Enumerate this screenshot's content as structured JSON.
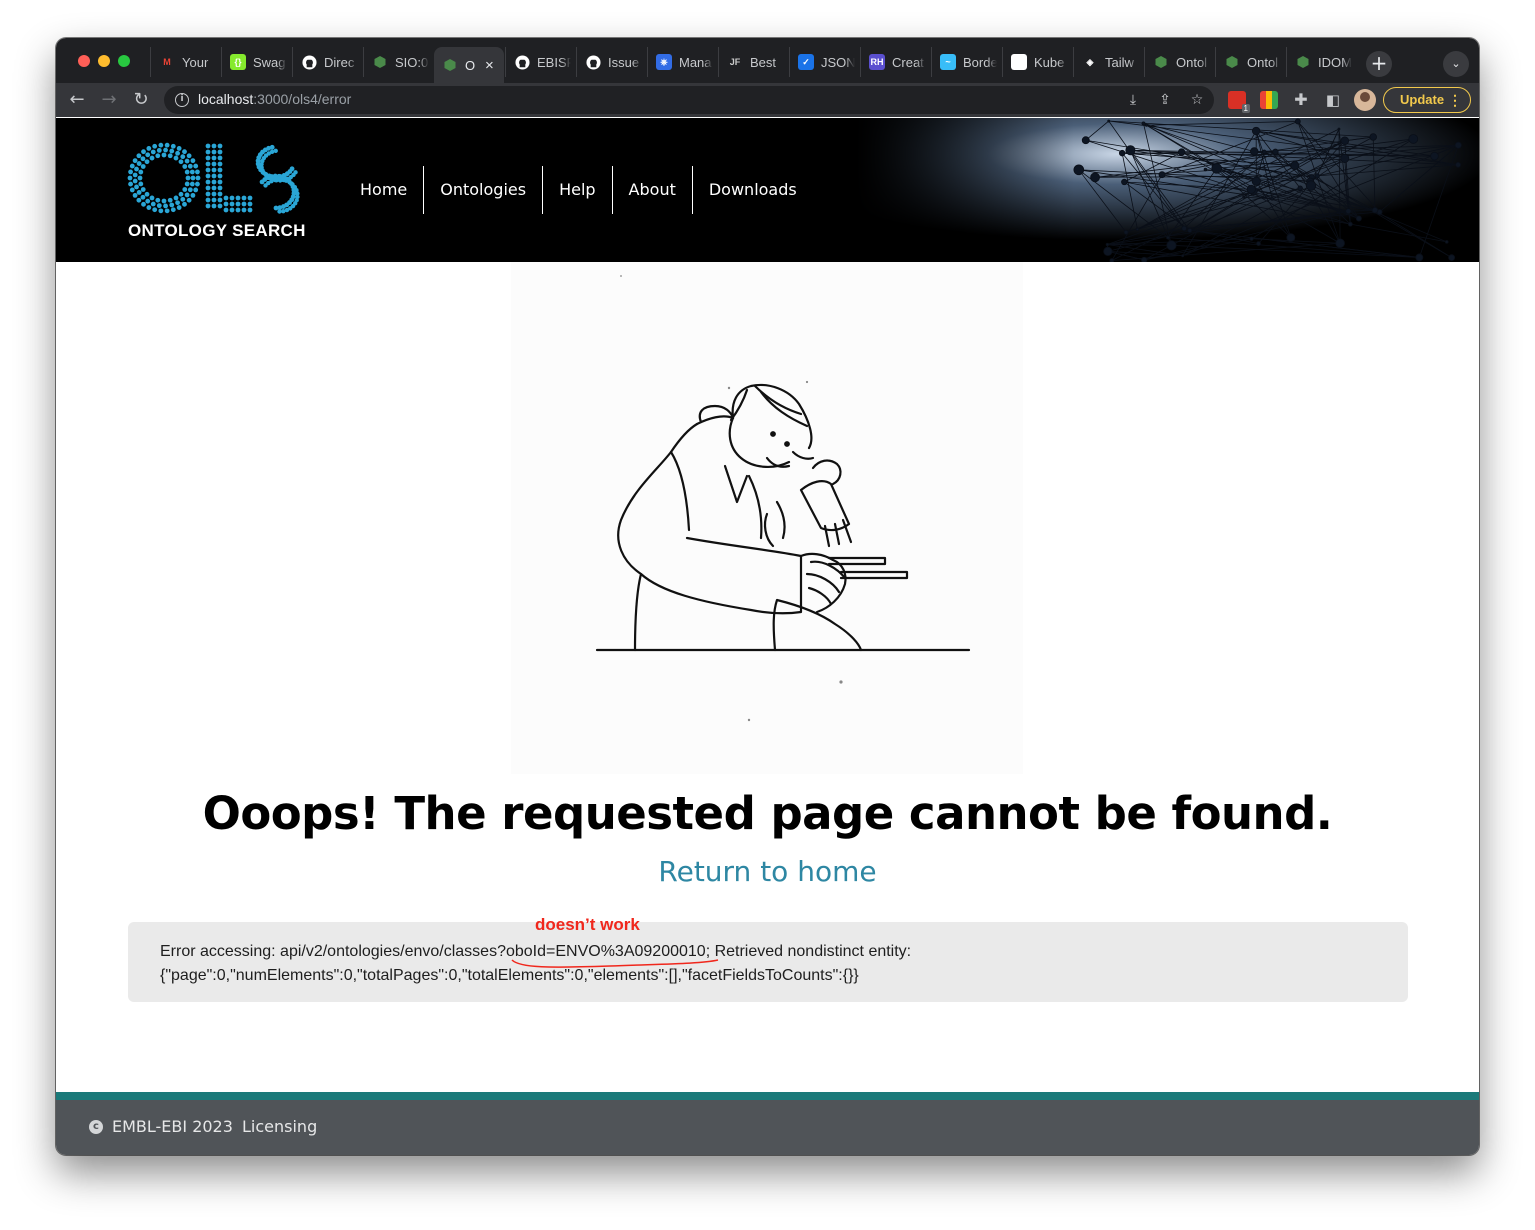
{
  "browser": {
    "tabs": [
      {
        "title": "Your",
        "icon": "gmail-icon",
        "color": "#ea4335",
        "glyph": "M"
      },
      {
        "title": "Swag",
        "icon": "swagger-icon",
        "color": "#85ea2d",
        "glyph": "{}"
      },
      {
        "title": "Direc",
        "icon": "github-icon",
        "color": "#ffffff",
        "glyph": ""
      },
      {
        "title": "SIO:0",
        "icon": "hexagon-icon",
        "color": "#4a8a4a",
        "glyph": ""
      },
      {
        "title": "O",
        "icon": "hexagon-icon",
        "color": "#4a8a4a",
        "glyph": "",
        "active": true
      },
      {
        "title": "EBISF",
        "icon": "github-icon",
        "color": "#ffffff",
        "glyph": ""
      },
      {
        "title": "Issue",
        "icon": "github-icon",
        "color": "#ffffff",
        "glyph": ""
      },
      {
        "title": "Mana",
        "icon": "kubernetes-icon",
        "color": "#326ce5",
        "glyph": "⎈"
      },
      {
        "title": "Best",
        "icon": "jf-icon",
        "color": "#2b2b2b",
        "glyph": "JF"
      },
      {
        "title": "JSON",
        "icon": "checkbox-icon",
        "color": "#1a73e8",
        "glyph": "✓"
      },
      {
        "title": "Creat",
        "icon": "rh-icon",
        "color": "#5a4fcf",
        "glyph": "RH"
      },
      {
        "title": "Borde",
        "icon": "tailwind-icon",
        "color": "#38bdf8",
        "glyph": "~"
      },
      {
        "title": "Kube",
        "icon": "page-icon",
        "color": "#e8eaed",
        "glyph": ""
      },
      {
        "title": "Tailw",
        "icon": "codepen-icon",
        "color": "#ffffff",
        "glyph": "◈"
      },
      {
        "title": "Ontol",
        "icon": "hexagon-icon",
        "color": "#4a8a4a",
        "glyph": ""
      },
      {
        "title": "Ontol",
        "icon": "hexagon-icon",
        "color": "#4a8a4a",
        "glyph": ""
      },
      {
        "title": "IDOM",
        "icon": "hexagon-icon",
        "color": "#4a8a4a",
        "glyph": ""
      }
    ],
    "url_host": "localhost",
    "url_path": ":3000/ols4/error",
    "update_label": "Update",
    "extension_badge": "1"
  },
  "site": {
    "logo_text": "OLS",
    "logo_tagline": "ONTOLOGY SEARCH",
    "nav": [
      "Home",
      "Ontologies",
      "Help",
      "About",
      "Downloads"
    ]
  },
  "error": {
    "title": "Ooops! The requested page cannot be found.",
    "return_link": "Return to home",
    "message_prefix": "Error accessing: api/v2/ontologies/envo/classes?",
    "message_highlight": "oboId=ENVO%3A09200010",
    "message_suffix": "; Retrieved nondistinct entity:",
    "message_line2": "{\"page\":0,\"numElements\":0,\"totalPages\":0,\"totalElements\":0,\"elements\":[],\"facetFieldsToCounts\":{}}"
  },
  "annotation": {
    "label": "doesn’t work",
    "color": "#f0271c"
  },
  "footer": {
    "copyright": "EMBL-EBI 2023",
    "licensing": "Licensing",
    "stripe_color": "#1b7a7a",
    "background_color": "#505458"
  },
  "colors": {
    "link": "#2e87a3",
    "logo_blue": "#2aa6d6"
  }
}
